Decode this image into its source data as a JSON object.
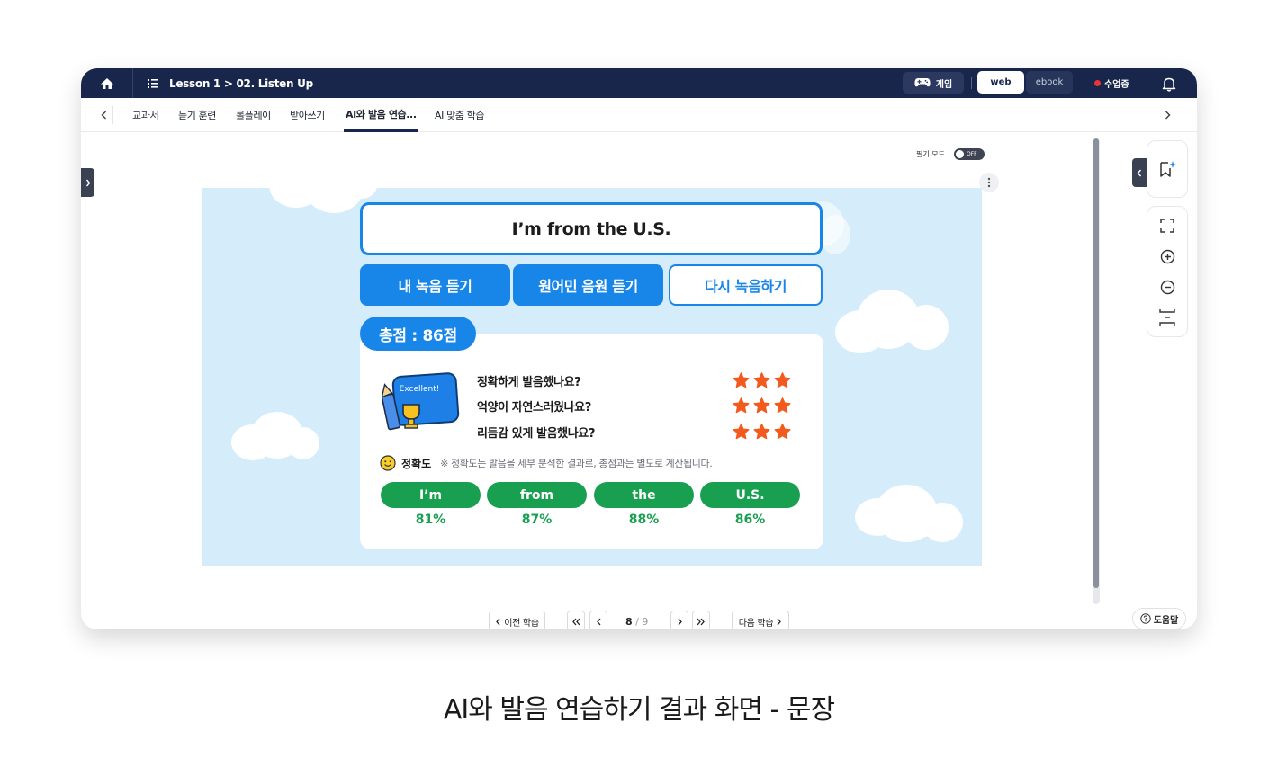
{
  "colors": {
    "nav_bg": "#18264b",
    "primary_blue": "#1886e8",
    "green": "#18a050",
    "star": "#f25a1e",
    "stage_bg": "#d5ecfb"
  },
  "topbar": {
    "home_icon": "home-icon",
    "breadcrumb": "Lesson 1 > 02. Listen Up",
    "game_label": "게임",
    "web_label": "web",
    "ebook_label": "ebook",
    "live_label": "수업중"
  },
  "tabs": [
    "교과서",
    "듣기 훈련",
    "롤플레이",
    "받아쓰기",
    "AI와 발음 연습...",
    "AI 맞춤 학습"
  ],
  "active_tab_index": 4,
  "note_mode": {
    "label": "필기 모드",
    "state": "OFF"
  },
  "activity": {
    "sentence": "I’m from the U.S.",
    "buttons": [
      "내 녹음 듣기",
      "원어민 음원 듣기",
      "다시 녹음하기"
    ],
    "total_score": "총점 : 86점",
    "badge_text": "Excellent!",
    "questions": [
      {
        "text": "정확하게 발음했나요?",
        "stars": 3
      },
      {
        "text": "억양이 자연스러웠나요?",
        "stars": 3
      },
      {
        "text": "리듬감 있게 발음했나요?",
        "stars": 3
      }
    ],
    "accuracy_title": "정확도",
    "accuracy_note": "※ 정확도는 발음을 세부 분석한 결과로, 총점과는 별도로 계산됩니다.",
    "words": [
      {
        "word": "I’m",
        "percent": "81%"
      },
      {
        "word": "from",
        "percent": "87%"
      },
      {
        "word": "the",
        "percent": "88%"
      },
      {
        "word": "U.S.",
        "percent": "86%"
      }
    ]
  },
  "pager": {
    "prev_label": "이전 학습",
    "next_label": "다음 학습",
    "current_page": "8",
    "total_pages": "/ 9"
  },
  "help_label": "도움말",
  "caption": "AI와 발음 연습하기 결과 화면 - 문장"
}
